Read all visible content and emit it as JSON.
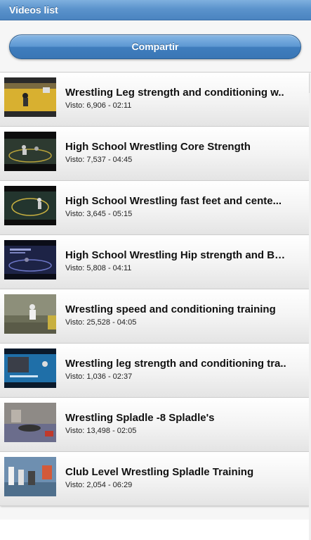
{
  "header": {
    "title": "Videos list"
  },
  "share_button": {
    "label": "Compartir"
  },
  "videos": [
    {
      "title": "Wrestling Leg strength and conditioning w..",
      "meta": "Visto: 6,906 - 02:11",
      "thumbnail": "gym-mat-yellow-thumbnail"
    },
    {
      "title": "High School Wrestling Core Strength",
      "meta": "Visto: 7,537 - 04:45",
      "thumbnail": "dark-mat-thumbnail"
    },
    {
      "title": "High School Wrestling fast feet and cente...",
      "meta": "Visto: 3,645 - 05:15",
      "thumbnail": "dark-mat-thumbnail"
    },
    {
      "title": "High School Wrestling Hip strength and Ba...",
      "meta": "Visto: 5,808 - 04:11",
      "thumbnail": "blue-title-card-thumbnail"
    },
    {
      "title": "Wrestling speed and conditioning training",
      "meta": "Visto: 25,528 - 04:05",
      "thumbnail": "gym-wall-thumbnail"
    },
    {
      "title": "Wrestling leg strength and conditioning tra..",
      "meta": "Visto: 1,036 - 02:37",
      "thumbnail": "blue-mat-thumbnail"
    },
    {
      "title": "Wrestling Spladle -8 Spladle's",
      "meta": "Visto: 13,498 - 02:05",
      "thumbnail": "mat-red-thumbnail"
    },
    {
      "title": "Club Level Wrestling Spladle Training",
      "meta": "Visto: 2,054 - 06:29",
      "thumbnail": "club-room-thumbnail"
    }
  ]
}
